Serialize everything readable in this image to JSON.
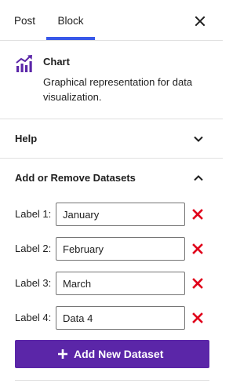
{
  "tabs": [
    {
      "label": "Post",
      "active": false
    },
    {
      "label": "Block",
      "active": true
    }
  ],
  "close_icon": "close-icon",
  "block": {
    "icon": "chart-icon",
    "title": "Chart",
    "description": "Graphical representation for data visualization."
  },
  "panels": {
    "help": {
      "title": "Help",
      "expanded": false
    },
    "datasets": {
      "title": "Add or Remove Datasets",
      "expanded": true
    }
  },
  "datasets": [
    {
      "label": "Label 1:",
      "value": "January"
    },
    {
      "label": "Label 2:",
      "value": "February"
    },
    {
      "label": "Label 3:",
      "value": "March"
    },
    {
      "label": "Label 4:",
      "value": "Data 4"
    }
  ],
  "add_button": {
    "label": "Add New Dataset"
  },
  "colors": {
    "accent": "#3858e9",
    "brand": "#5b26a8",
    "remove": "#e0001a"
  }
}
